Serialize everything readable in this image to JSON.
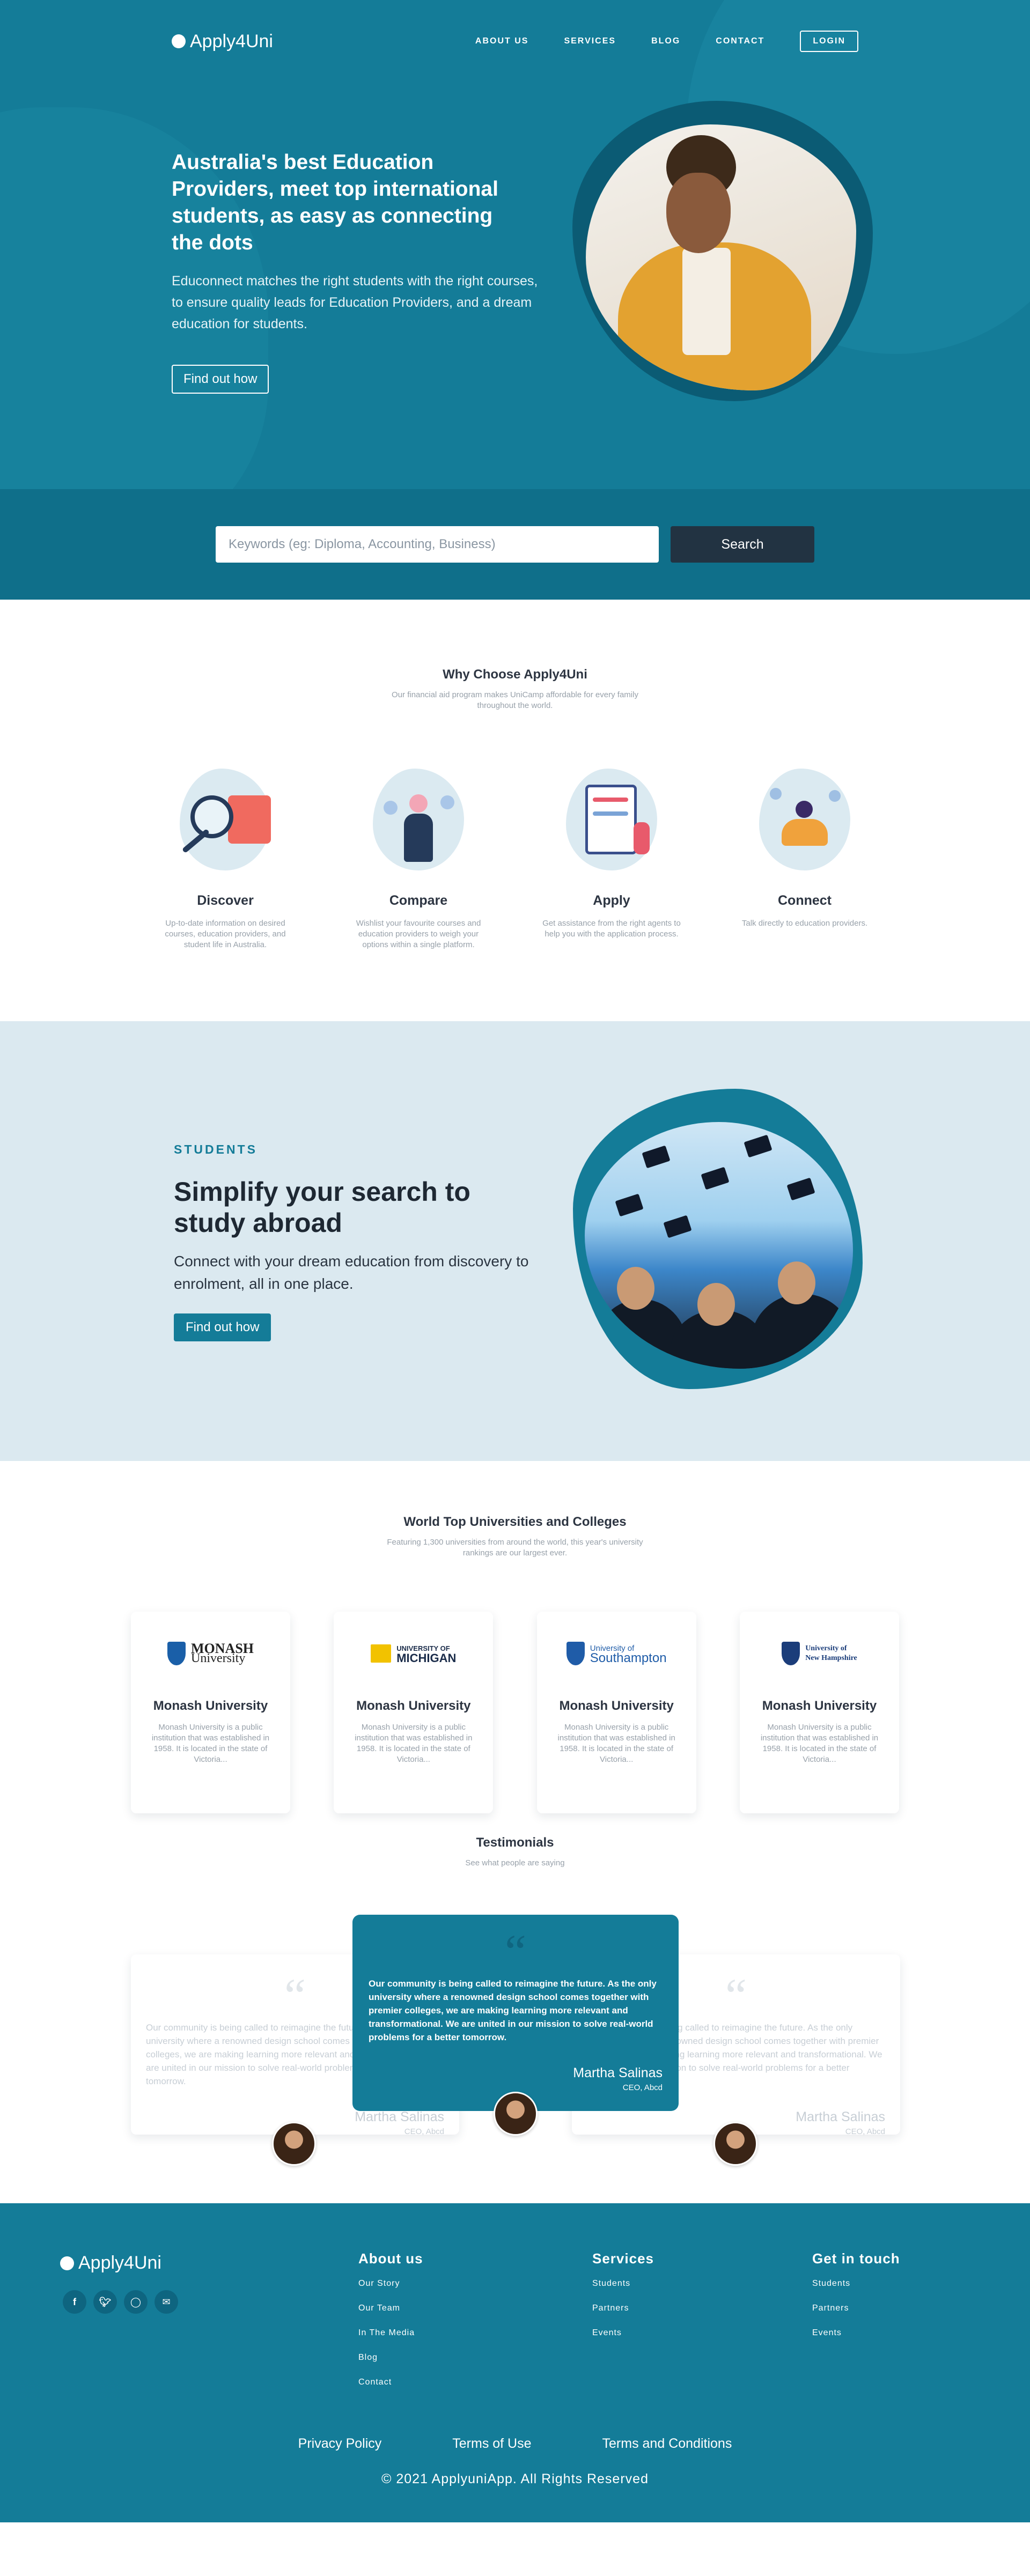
{
  "nav": {
    "logo": "Apply4Uni",
    "links": [
      "ABOUT US",
      "SERVICES",
      "BLOG",
      "CONTACT"
    ],
    "login": "LOGIN"
  },
  "hero": {
    "title": "Australia's best Education Providers, meet top international students, as easy as connecting the dots",
    "text": "Educonnect matches the right students with the right courses, to ensure quality leads for Education Providers, and a dream education for students.",
    "cta": "Find out how"
  },
  "search": {
    "placeholder": "Keywords (eg: Diploma, Accounting, Business)",
    "button": "Search"
  },
  "why": {
    "title": "Why Choose Apply4Uni",
    "subtitle": "Our financial aid program makes UniCamp affordable for every family throughout the world.",
    "features": [
      {
        "title": "Discover",
        "text": "Up-to-date information on desired courses, education providers, and student life in Australia."
      },
      {
        "title": "Compare",
        "text": "Wishlist your favourite courses and education providers to weigh your options within a single platform."
      },
      {
        "title": "Apply",
        "text": "Get assistance from the right agents to help you with the application process."
      },
      {
        "title": "Connect",
        "text": "Talk directly to education providers."
      }
    ]
  },
  "students": {
    "eyebrow": "STUDENTS",
    "title": "Simplify your search to study abroad",
    "text": "Connect with your dream education from discovery to enrolment, all in one place.",
    "cta": "Find out how"
  },
  "universities": {
    "title": "World Top Universities and Colleges",
    "subtitle": "Featuring 1,300 universities from around the world, this year's university rankings are our largest ever.",
    "cards": [
      {
        "logo_line1": "MONASH",
        "logo_line2": "University",
        "name": "Monash University",
        "desc": "Monash University is a public institution that was established in 1958. It is located in the state of Victoria..."
      },
      {
        "logo_line1": "UNIVERSITY OF",
        "logo_line2": "MICHIGAN",
        "name": "Monash University",
        "desc": "Monash University is a public institution that was established in 1958. It is located in the state of Victoria..."
      },
      {
        "logo_line1": "University of",
        "logo_line2": "Southampton",
        "name": "Monash University",
        "desc": "Monash University is a public institution that was established in 1958. It is located in the state of Victoria..."
      },
      {
        "logo_line1": "University of",
        "logo_line2": "New Hampshire",
        "name": "Monash University",
        "desc": "Monash University is a public institution that was established in 1958. It is located in the state of Victoria..."
      }
    ],
    "brand_colors": [
      "#1a5fa8",
      "#f2c200",
      "#1f5ca8",
      "#1b3d7a"
    ]
  },
  "testimonials": {
    "title": "Testimonials",
    "subtitle": "See what people are saying",
    "items": [
      {
        "text": "Our community is being called to reimagine the future. As the only university where a renowned design school comes together with premier colleges, we are making learning more relevant and transformational. We are united in our mission to solve real-world problems for a better tomorrow.",
        "name": "Martha Salinas",
        "role": "CEO, Abcd"
      },
      {
        "text": "Our community is being called to reimagine the future. As the only university where a renowned design school comes together with premier colleges, we are making learning more relevant and transformational. We are united in our mission to solve real-world problems for a better tomorrow.",
        "name": "Martha Salinas",
        "role": "CEO, Abcd"
      },
      {
        "text": "Our community is being called to reimagine the future. As the only university where a renowned design school comes together with premier colleges, we are making learning more relevant and transformational. We are united in our mission to solve real-world problems for a better tomorrow.",
        "name": "Martha Salinas",
        "role": "CEO, Abcd"
      }
    ]
  },
  "footer": {
    "logo": "Apply4Uni",
    "social_icons": [
      "facebook-icon",
      "twitter-icon",
      "instagram-icon",
      "mail-icon"
    ],
    "columns": [
      {
        "title": "About us",
        "items": [
          "Our Story",
          "Our Team",
          "In The Media",
          "Blog",
          "Contact"
        ]
      },
      {
        "title": "Services",
        "items": [
          "Students",
          "Partners",
          "Events"
        ]
      },
      {
        "title": "Get in touch",
        "items": [
          "Students",
          "Partners",
          "Events"
        ]
      }
    ],
    "bottom_links": [
      "Privacy Policy",
      "Terms of Use",
      "Terms and Conditions"
    ],
    "copyright": "© 2021 ApplyuniApp. All Rights Reserved"
  },
  "colors": {
    "primary": "#147c98",
    "dark": "#223342",
    "light_section": "#dbe9f0"
  }
}
